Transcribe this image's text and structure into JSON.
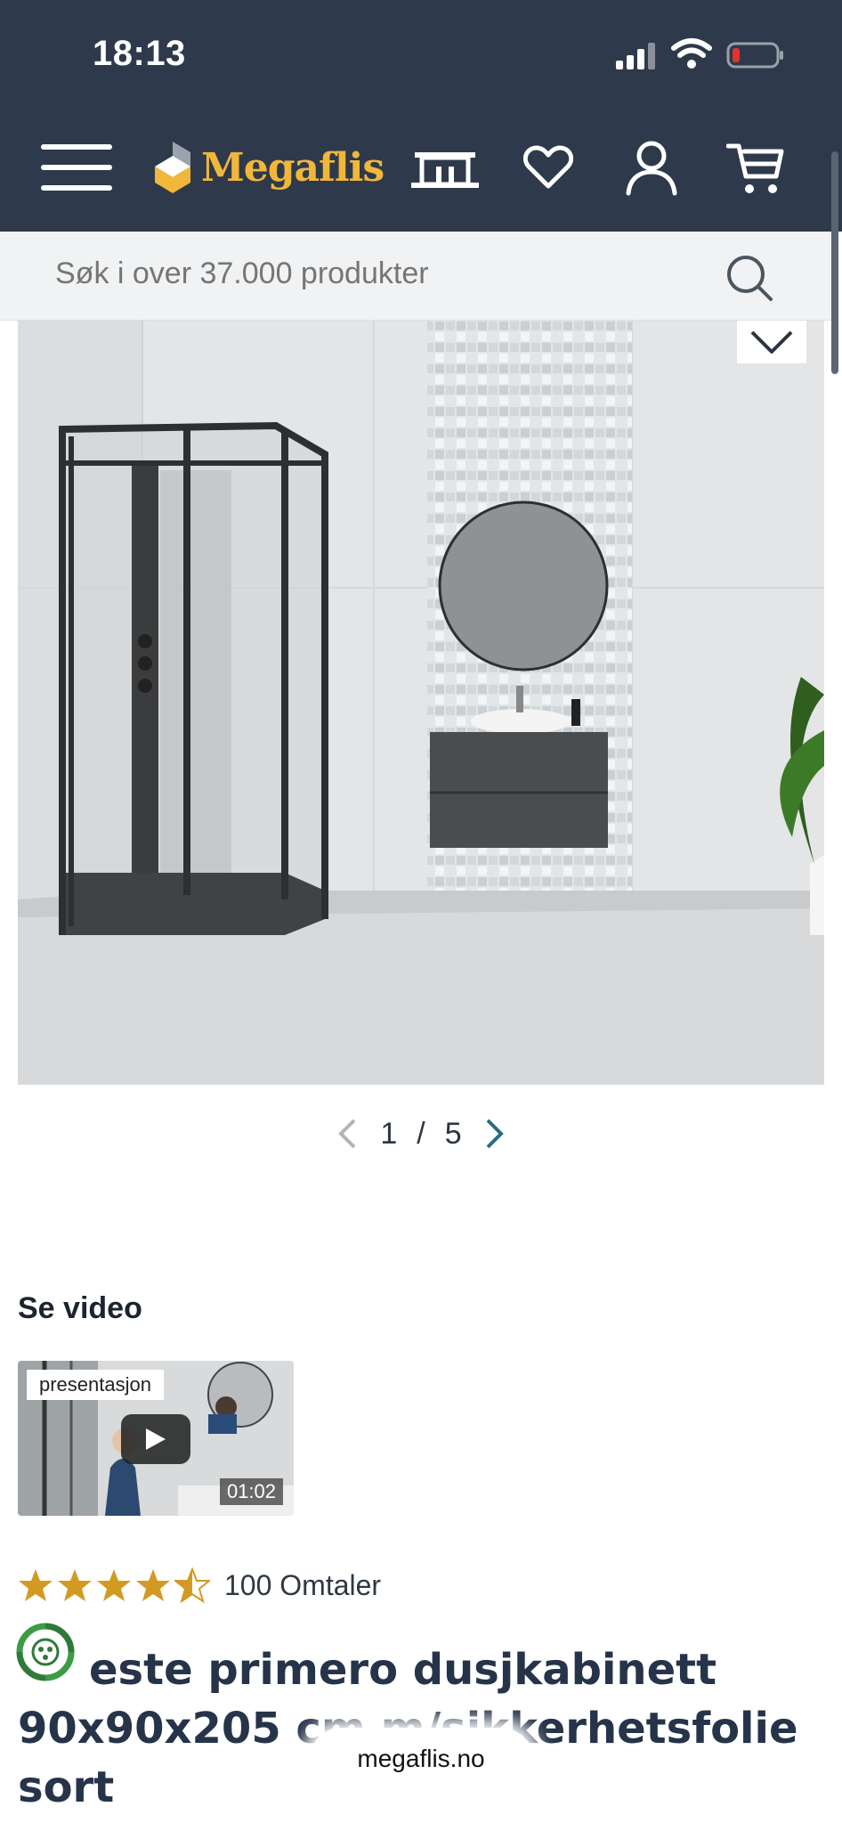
{
  "status_bar": {
    "time": "18:13"
  },
  "header": {
    "logo_text": "Megaflis",
    "icons": [
      "menu-icon",
      "store-icon",
      "heart-icon",
      "user-icon",
      "cart-icon"
    ],
    "colors": {
      "background": "#2e3a4b",
      "logo": "#f0b73b"
    }
  },
  "search": {
    "placeholder": "Søk i over 37.000 produkter"
  },
  "gallery": {
    "current": "1",
    "separator": "/",
    "total": "5"
  },
  "video": {
    "heading": "Se video",
    "label": "presentasjon",
    "duration": "01:02"
  },
  "rating": {
    "stars": 4.5,
    "count_text": "100 Omtaler",
    "star_color": "#d39a23"
  },
  "product": {
    "title": "este primero dusjkabinett 90x90x205 cm m/sikkerhetsfolie sort"
  },
  "browser": {
    "url": "megaflis.no"
  }
}
